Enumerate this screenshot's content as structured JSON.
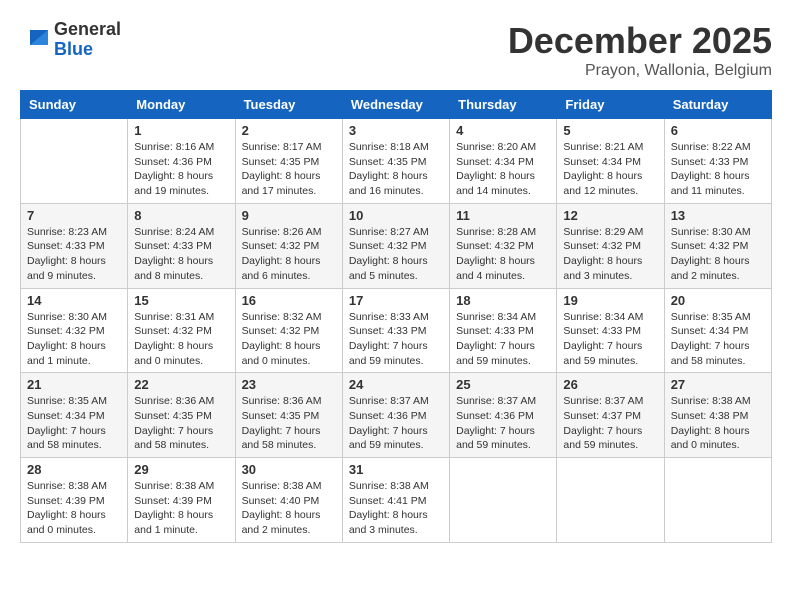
{
  "logo": {
    "general": "General",
    "blue": "Blue"
  },
  "title": "December 2025",
  "location": "Prayon, Wallonia, Belgium",
  "weekdays": [
    "Sunday",
    "Monday",
    "Tuesday",
    "Wednesday",
    "Thursday",
    "Friday",
    "Saturday"
  ],
  "rows": [
    [
      {
        "day": "",
        "info": ""
      },
      {
        "day": "1",
        "info": "Sunrise: 8:16 AM\nSunset: 4:36 PM\nDaylight: 8 hours\nand 19 minutes."
      },
      {
        "day": "2",
        "info": "Sunrise: 8:17 AM\nSunset: 4:35 PM\nDaylight: 8 hours\nand 17 minutes."
      },
      {
        "day": "3",
        "info": "Sunrise: 8:18 AM\nSunset: 4:35 PM\nDaylight: 8 hours\nand 16 minutes."
      },
      {
        "day": "4",
        "info": "Sunrise: 8:20 AM\nSunset: 4:34 PM\nDaylight: 8 hours\nand 14 minutes."
      },
      {
        "day": "5",
        "info": "Sunrise: 8:21 AM\nSunset: 4:34 PM\nDaylight: 8 hours\nand 12 minutes."
      },
      {
        "day": "6",
        "info": "Sunrise: 8:22 AM\nSunset: 4:33 PM\nDaylight: 8 hours\nand 11 minutes."
      }
    ],
    [
      {
        "day": "7",
        "info": "Sunrise: 8:23 AM\nSunset: 4:33 PM\nDaylight: 8 hours\nand 9 minutes."
      },
      {
        "day": "8",
        "info": "Sunrise: 8:24 AM\nSunset: 4:33 PM\nDaylight: 8 hours\nand 8 minutes."
      },
      {
        "day": "9",
        "info": "Sunrise: 8:26 AM\nSunset: 4:32 PM\nDaylight: 8 hours\nand 6 minutes."
      },
      {
        "day": "10",
        "info": "Sunrise: 8:27 AM\nSunset: 4:32 PM\nDaylight: 8 hours\nand 5 minutes."
      },
      {
        "day": "11",
        "info": "Sunrise: 8:28 AM\nSunset: 4:32 PM\nDaylight: 8 hours\nand 4 minutes."
      },
      {
        "day": "12",
        "info": "Sunrise: 8:29 AM\nSunset: 4:32 PM\nDaylight: 8 hours\nand 3 minutes."
      },
      {
        "day": "13",
        "info": "Sunrise: 8:30 AM\nSunset: 4:32 PM\nDaylight: 8 hours\nand 2 minutes."
      }
    ],
    [
      {
        "day": "14",
        "info": "Sunrise: 8:30 AM\nSunset: 4:32 PM\nDaylight: 8 hours\nand 1 minute."
      },
      {
        "day": "15",
        "info": "Sunrise: 8:31 AM\nSunset: 4:32 PM\nDaylight: 8 hours\nand 0 minutes."
      },
      {
        "day": "16",
        "info": "Sunrise: 8:32 AM\nSunset: 4:32 PM\nDaylight: 8 hours\nand 0 minutes."
      },
      {
        "day": "17",
        "info": "Sunrise: 8:33 AM\nSunset: 4:33 PM\nDaylight: 7 hours\nand 59 minutes."
      },
      {
        "day": "18",
        "info": "Sunrise: 8:34 AM\nSunset: 4:33 PM\nDaylight: 7 hours\nand 59 minutes."
      },
      {
        "day": "19",
        "info": "Sunrise: 8:34 AM\nSunset: 4:33 PM\nDaylight: 7 hours\nand 59 minutes."
      },
      {
        "day": "20",
        "info": "Sunrise: 8:35 AM\nSunset: 4:34 PM\nDaylight: 7 hours\nand 58 minutes."
      }
    ],
    [
      {
        "day": "21",
        "info": "Sunrise: 8:35 AM\nSunset: 4:34 PM\nDaylight: 7 hours\nand 58 minutes."
      },
      {
        "day": "22",
        "info": "Sunrise: 8:36 AM\nSunset: 4:35 PM\nDaylight: 7 hours\nand 58 minutes."
      },
      {
        "day": "23",
        "info": "Sunrise: 8:36 AM\nSunset: 4:35 PM\nDaylight: 7 hours\nand 58 minutes."
      },
      {
        "day": "24",
        "info": "Sunrise: 8:37 AM\nSunset: 4:36 PM\nDaylight: 7 hours\nand 59 minutes."
      },
      {
        "day": "25",
        "info": "Sunrise: 8:37 AM\nSunset: 4:36 PM\nDaylight: 7 hours\nand 59 minutes."
      },
      {
        "day": "26",
        "info": "Sunrise: 8:37 AM\nSunset: 4:37 PM\nDaylight: 7 hours\nand 59 minutes."
      },
      {
        "day": "27",
        "info": "Sunrise: 8:38 AM\nSunset: 4:38 PM\nDaylight: 8 hours\nand 0 minutes."
      }
    ],
    [
      {
        "day": "28",
        "info": "Sunrise: 8:38 AM\nSunset: 4:39 PM\nDaylight: 8 hours\nand 0 minutes."
      },
      {
        "day": "29",
        "info": "Sunrise: 8:38 AM\nSunset: 4:39 PM\nDaylight: 8 hours\nand 1 minute."
      },
      {
        "day": "30",
        "info": "Sunrise: 8:38 AM\nSunset: 4:40 PM\nDaylight: 8 hours\nand 2 minutes."
      },
      {
        "day": "31",
        "info": "Sunrise: 8:38 AM\nSunset: 4:41 PM\nDaylight: 8 hours\nand 3 minutes."
      },
      {
        "day": "",
        "info": ""
      },
      {
        "day": "",
        "info": ""
      },
      {
        "day": "",
        "info": ""
      }
    ]
  ]
}
